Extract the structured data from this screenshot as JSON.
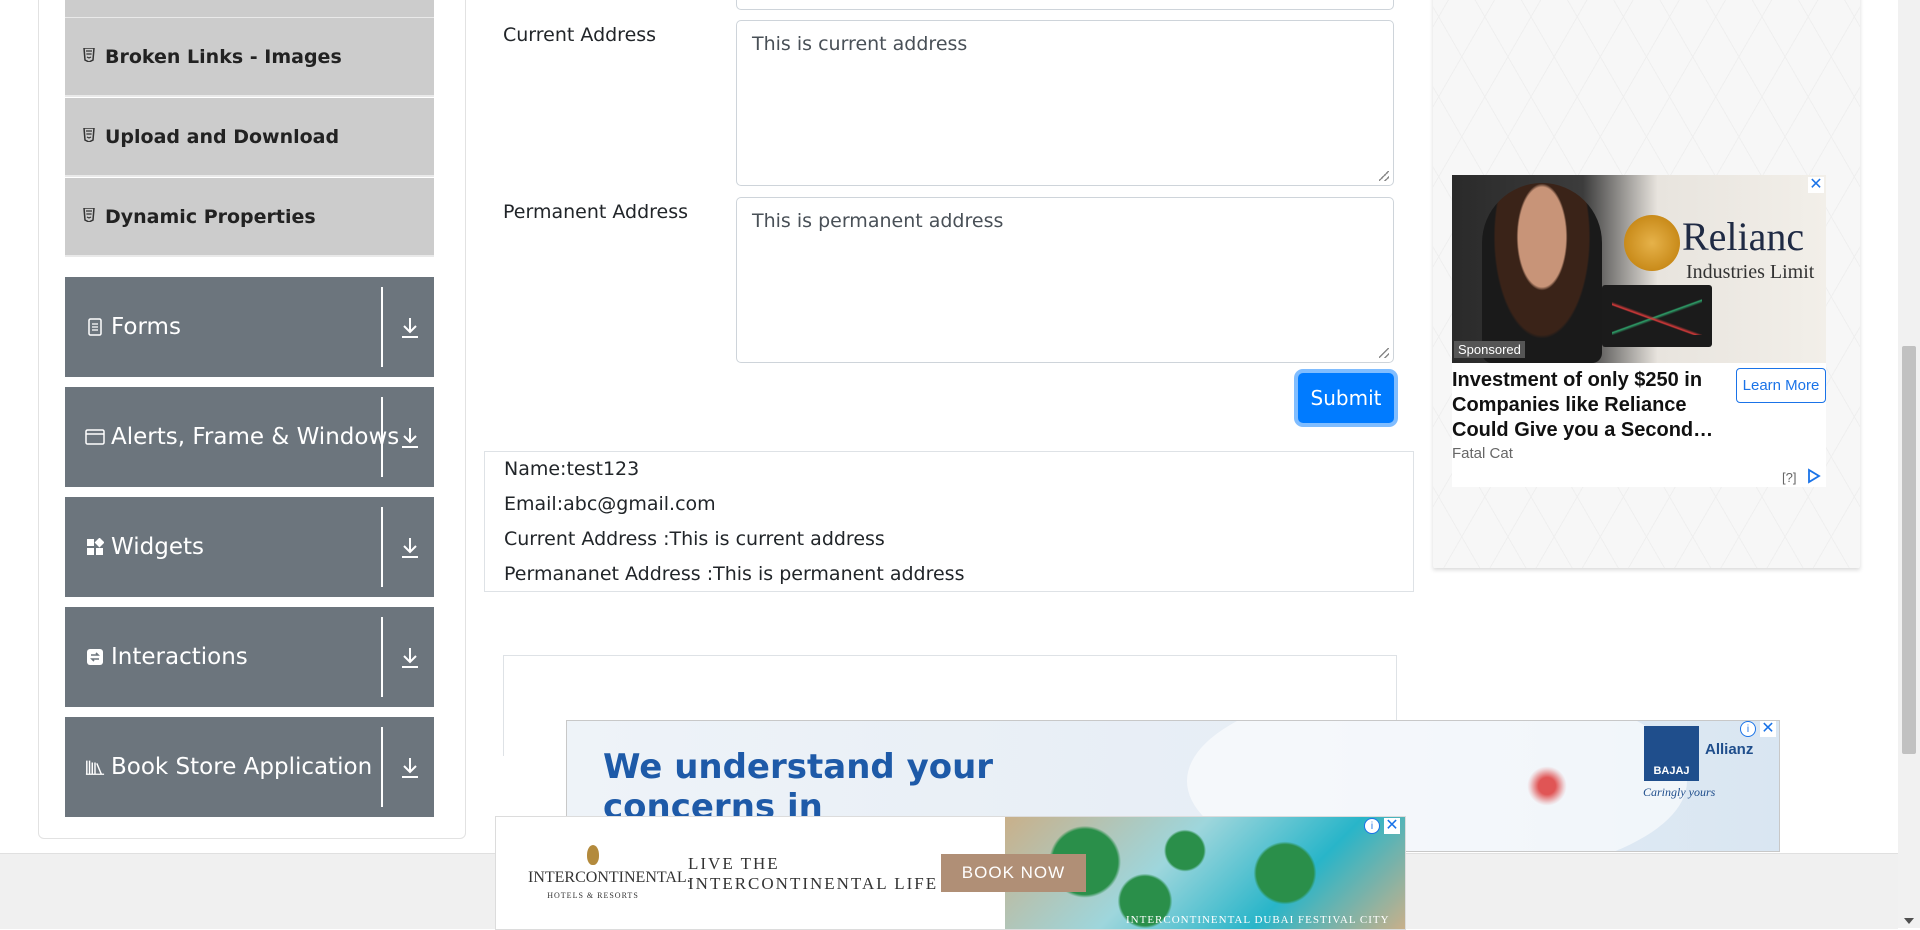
{
  "sidebar": {
    "sub_items": [
      {
        "label": "Broken Links - Images",
        "icon": "html5-icon"
      },
      {
        "label": "Upload and Download",
        "icon": "html5-icon"
      },
      {
        "label": "Dynamic Properties",
        "icon": "html5-icon"
      }
    ],
    "groups": [
      {
        "label": "Forms",
        "icon": "document-icon"
      },
      {
        "label": "Alerts, Frame & Windows",
        "icon": "window-icon"
      },
      {
        "label": "Widgets",
        "icon": "widgets-icon"
      },
      {
        "label": "Interactions",
        "icon": "interactions-icon"
      },
      {
        "label": "Book Store Application",
        "icon": "books-icon"
      }
    ]
  },
  "form": {
    "current_address_label": "Current Address",
    "current_address_value": "This is current address",
    "permanent_address_label": "Permanent Address",
    "permanent_address_value": "This is permanent address",
    "submit_label": "Submit"
  },
  "output": {
    "name": "Name:test123",
    "email": "Email:abc@gmail.com",
    "current_address": "Current Address :This is current address",
    "permanent_address": "Permananet Address :This is permanent address"
  },
  "side_ad": {
    "brand": "Relianc",
    "brand_sub": "Industries Limit",
    "sponsored": "Sponsored",
    "headline": "Investment of only $250 in Companies like Reliance Could Give you a Second…",
    "cta": "Learn More",
    "source": "Fatal Cat",
    "help": "[?]"
  },
  "banner_ad": {
    "headline": "We understand your concerns in emergencies",
    "brand": "BAJAJ",
    "partner": "Allianz",
    "slogan": "Caringly yours"
  },
  "ic_ad": {
    "logo_name": "INTERCONTINENTAL.",
    "logo_sub": "HOTELS & RESORTS",
    "tagline_line1": "LIVE THE",
    "tagline_line2": "INTERCONTINENTAL LIFE",
    "cta": "BOOK NOW",
    "caption": "INTERCONTINENTAL DUBAI FESTIVAL CITY"
  },
  "colors": {
    "sidebar_group_bg": "#6c757d",
    "sidebar_sub_bg": "#cccccc",
    "primary": "#007bff",
    "ad_link": "#1a73e8"
  }
}
